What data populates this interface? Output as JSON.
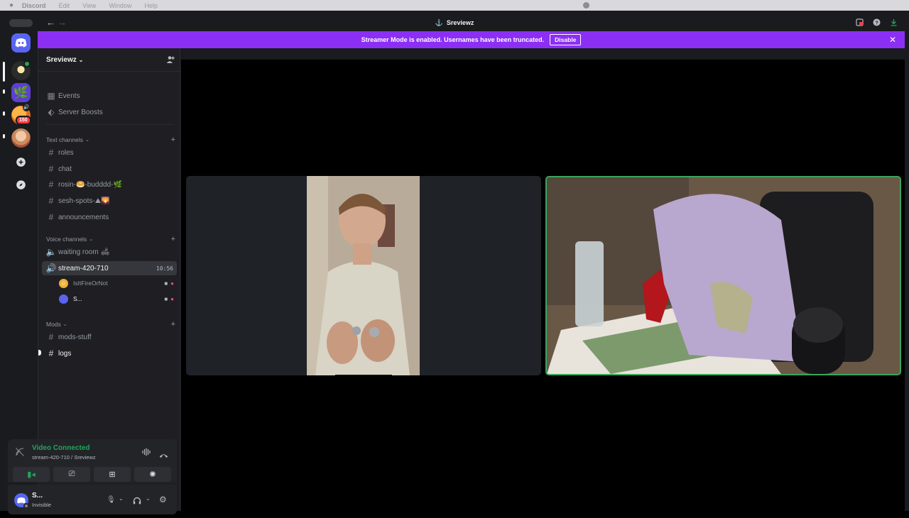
{
  "menubar": {
    "app": "Discord",
    "items": [
      "Edit",
      "View",
      "Window",
      "Help"
    ]
  },
  "window": {
    "title": "Sreviewz"
  },
  "banner": {
    "text": "Streamer Mode is enabled. Usernames have been truncated.",
    "disable_label": "Disable"
  },
  "servers": [
    {
      "name": "Sreviewz",
      "selected": true
    },
    {
      "name": "cannabis-server"
    },
    {
      "name": "orange-server",
      "badge": "150"
    },
    {
      "name": "portrait-server"
    }
  ],
  "sidebar": {
    "server_name": "Sreviewz",
    "top_items": [
      {
        "label": "Events",
        "icon": "calendar-icon"
      },
      {
        "label": "Server Boosts",
        "icon": "boost-icon"
      }
    ],
    "text_category": "Text channels",
    "text_channels": [
      {
        "label": "roles"
      },
      {
        "label": "chat"
      },
      {
        "label": "rosin-",
        "emoji1": "🥯",
        "mid": "-budddd-",
        "emoji2": "🌿"
      },
      {
        "label": "sesh-spots-",
        "emoji1": "⛰",
        "emoji2": "🌄"
      },
      {
        "label": "announcements"
      }
    ],
    "voice_category": "Voice channels",
    "voice_channels": [
      {
        "label": "waiting room",
        "emoji": "🛋"
      },
      {
        "label": "stream-420-710",
        "timer": "10:56"
      }
    ],
    "voice_users": [
      {
        "name": "IsItFireOrNot"
      },
      {
        "name": "S..."
      }
    ],
    "mods_category": "Mods",
    "mods_channels": [
      {
        "label": "mods-stuff"
      },
      {
        "label": "logs"
      }
    ]
  },
  "voice_panel": {
    "status": "Video Connected",
    "channel": "stream-420-710 / Sreviewz"
  },
  "user_panel": {
    "name": "S...",
    "status": "Invisible"
  },
  "colors": {
    "banner": "#8b2ff5",
    "connected": "#23a55a",
    "accent_speaking": "#3ba55d"
  }
}
